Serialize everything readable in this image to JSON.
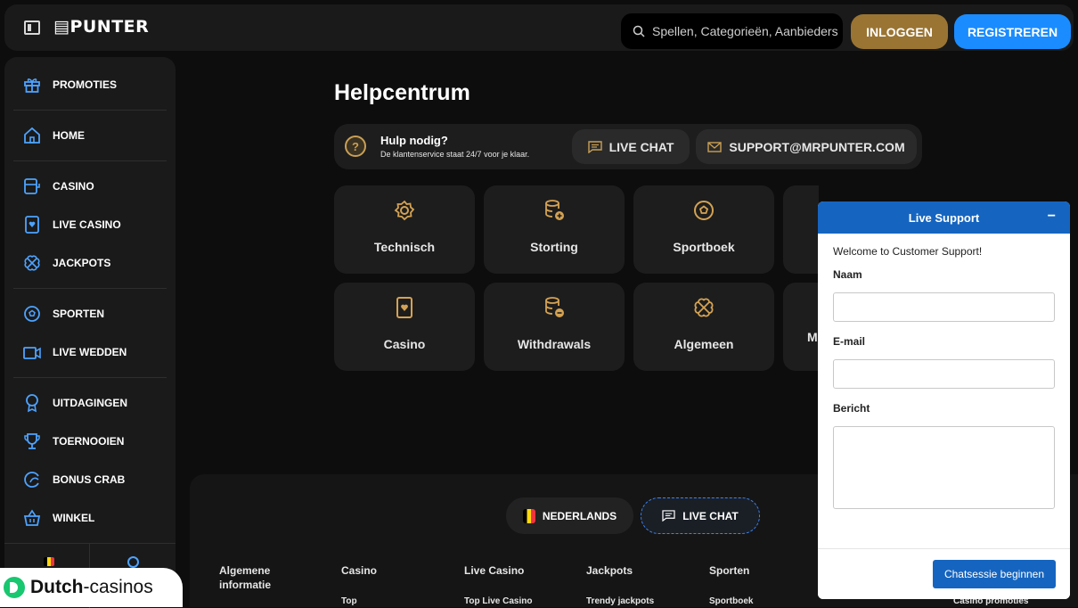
{
  "header": {
    "logo": "▤PUNTER",
    "search_placeholder": "Spellen, Categorieën, Aanbieders",
    "login_label": "INLOGGEN",
    "register_label": "REGISTREREN"
  },
  "sidebar": {
    "items": [
      {
        "label": "PROMOTIES",
        "icon": "gift-icon"
      },
      {
        "label": "HOME",
        "icon": "home-icon"
      },
      {
        "label": "CASINO",
        "icon": "slot-machine-icon"
      },
      {
        "label": "LIVE CASINO",
        "icon": "card-icon"
      },
      {
        "label": "JACKPOTS",
        "icon": "clover-icon"
      },
      {
        "label": "SPORTEN",
        "icon": "football-icon"
      },
      {
        "label": "LIVE WEDDEN",
        "icon": "video-icon"
      },
      {
        "label": "UITDAGINGEN",
        "icon": "medal-icon"
      },
      {
        "label": "TOERNOOIEN",
        "icon": "trophy-icon"
      },
      {
        "label": "BONUS CRAB",
        "icon": "crab-icon"
      },
      {
        "label": "WINKEL",
        "icon": "basket-icon"
      }
    ]
  },
  "main": {
    "title": "Helpcentrum",
    "help_title": "Hulp nodig?",
    "help_subtitle": "De klantenservice staat 24/7 voor je klaar.",
    "live_chat_label": "LIVE CHAT",
    "email_label": "SUPPORT@MRPUNTER.COM",
    "categories": [
      {
        "label": "Technisch",
        "icon": "gear-icon"
      },
      {
        "label": "Storting",
        "icon": "coins-plus-icon"
      },
      {
        "label": "Sportboek",
        "icon": "football-icon"
      },
      {
        "label": "Casino",
        "icon": "card-icon"
      },
      {
        "label": "Withdrawals",
        "icon": "coins-minus-icon"
      },
      {
        "label": "Algemeen",
        "icon": "clover-icon"
      },
      {
        "label": "M",
        "icon": ""
      }
    ]
  },
  "footer": {
    "language_label": "NEDERLANDS",
    "live_chat_label": "LIVE CHAT",
    "columns": [
      {
        "heading": "Algemene informatie",
        "link": ""
      },
      {
        "heading": "Casino",
        "link": "Top"
      },
      {
        "heading": "Live Casino",
        "link": "Top Live Casino"
      },
      {
        "heading": "Jackpots",
        "link": "Trendy jackpots"
      },
      {
        "heading": "Sporten",
        "link": "Sportboek"
      },
      {
        "heading": "",
        "link": "Casino promoties"
      }
    ]
  },
  "chat": {
    "title": "Live Support",
    "minimize": "−",
    "welcome": "Welcome to Customer Support!",
    "name_label": "Naam",
    "email_label": "E-mail",
    "message_label": "Bericht",
    "name_value": "",
    "email_value": "",
    "message_value": "",
    "submit_label": "Chatsessie beginnen"
  },
  "watermark": {
    "brand_bold": "Dutch",
    "brand_rest": "-casinos"
  },
  "colors": {
    "accent_gold": "#9a7433",
    "accent_blue": "#1a8cff",
    "chat_blue": "#1565c0"
  }
}
